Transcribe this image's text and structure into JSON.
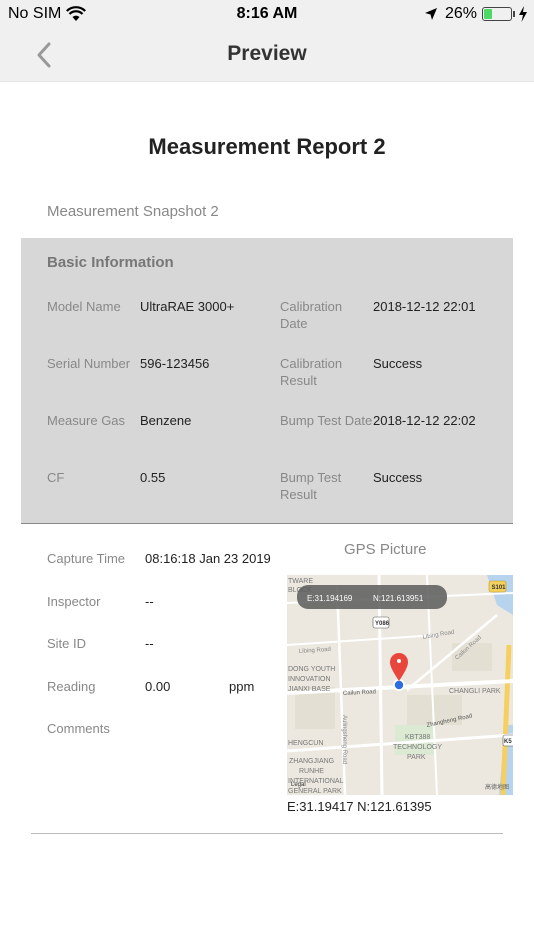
{
  "status_bar": {
    "carrier": "No SIM",
    "time": "8:16 AM",
    "battery_pct": "26%"
  },
  "nav": {
    "title": "Preview"
  },
  "report": {
    "title": "Measurement Report 2",
    "snapshot_title": "Measurement Snapshot 2"
  },
  "basic_info": {
    "title": "Basic Information",
    "model_name_label": "Model Name",
    "model_name_value": "UltraRAE 3000+",
    "serial_label": "Serial Number",
    "serial_value": "596-123456",
    "gas_label": "Measure Gas",
    "gas_value": "Benzene",
    "cf_label": "CF",
    "cf_value": "0.55",
    "cal_date_label_1": "Calibration",
    "cal_date_label_2": "Date",
    "cal_date_value": "2018-12-12 22:01",
    "cal_result_label_1": "Calibration",
    "cal_result_label_2": "Result",
    "cal_result_value": "Success",
    "bump_date_label": "Bump Test Date",
    "bump_date_value": "2018-12-12 22:02",
    "bump_result_label_1": "Bump Test",
    "bump_result_label_2": "Result",
    "bump_result_value": "Success"
  },
  "details": {
    "capture_time_label": "Capture Time",
    "capture_time_value": "08:16:18 Jan 23 2019",
    "inspector_label": "Inspector",
    "inspector_value": "--",
    "site_id_label": "Site ID",
    "site_id_value": "--",
    "reading_label": "Reading",
    "reading_value": "0.00",
    "reading_unit": "ppm",
    "comments_label": "Comments"
  },
  "gps": {
    "title": "GPS Picture",
    "map_e": "E:31.194169",
    "map_n": "N:121.613951",
    "coords": "E:31.19417 N:121.61395",
    "map_labels": {
      "softwareblock_1": "TWARE",
      "softwareblock_2": "BLOCK",
      "s101": "S101",
      "y086": "Y086",
      "libing1": "Libing Road",
      "libing2": "Libing Road",
      "cailun1": "Cailun Road",
      "cailun2": "Cailun Road",
      "dongyouth_1": "DONG YOUTH",
      "dongyouth_2": "INNOVATION",
      "dongyouth_3": "JIANXI BASE",
      "changli": "CHANGLI PARK",
      "zhangheng": "Zhangheng Road",
      "aulingsheng": "Aulingsheng Road",
      "hengcun": "HENGCUN",
      "kbt_1": "KBT388",
      "kbt_2": "TECHNOLOGY",
      "kbt_3": "PARK",
      "zj_1": "ZHANGJIANG",
      "zj_2": "RUNHE",
      "zj_3": "INTERNATIONAL",
      "zj_4": "GENERAL PARK",
      "k5": "K5",
      "legal": "Legal",
      "brand": "高德地图"
    }
  },
  "colors": {
    "nav_bg": "#f0f0f0",
    "basic_bg": "#d7d7d7",
    "label": "#888888",
    "map_pin": "#e8463d",
    "user_dot": "#2d6fe0"
  }
}
